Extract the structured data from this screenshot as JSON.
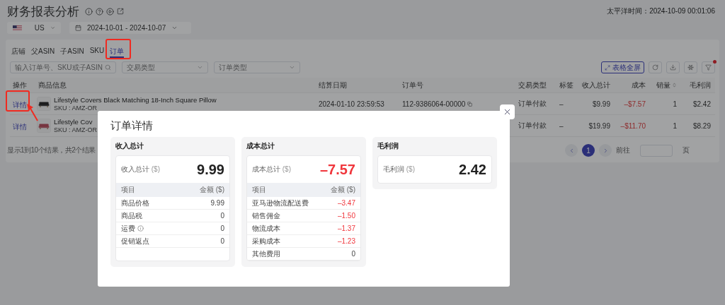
{
  "page": {
    "title": "财务报表分析",
    "timezone": "太平洋时间：2024-10-09 00:01:06"
  },
  "filters": {
    "country": "US",
    "date_range": "2024-10-01 - 2024-10-07"
  },
  "tabs": [
    {
      "label": "店铺",
      "selected": false
    },
    {
      "label": "父ASIN",
      "selected": false
    },
    {
      "label": "子ASIN",
      "selected": false
    },
    {
      "label": "SKU",
      "selected": false
    },
    {
      "label": "订单",
      "selected": true
    }
  ],
  "search": {
    "placeholder": "输入订单号、SKU或子ASIN"
  },
  "selects": [
    {
      "placeholder": "交易类型"
    },
    {
      "placeholder": "订单类型"
    }
  ],
  "toolbar": {
    "fullscreen": "表格全屏",
    "filter_active": true
  },
  "table": {
    "columns": [
      "操作",
      "商品信息",
      "结算日期",
      "订单号",
      "交易类型",
      "标签",
      "收入总计",
      "成本",
      "销量",
      "毛利润"
    ],
    "rows": [
      {
        "action": "详情",
        "title": "Lifestyle Covers Black Matching 18-Inch Square Pillow",
        "sku": "SKU : AMZ-OR",
        "date": "2024-01-10 23:59:53",
        "order": "112-9386064-00000",
        "type": "订单付款",
        "tag": "–",
        "income": "$9.99",
        "cost": "–$7.57",
        "qty": "1",
        "profit": "$2.42"
      },
      {
        "action": "详情",
        "title": "Lifestyle Cov",
        "sku": "SKU : AMZ-OR",
        "type": "订单付款",
        "tag": "–",
        "income": "$19.99",
        "cost": "–$11.70",
        "qty": "1",
        "profit": "$8.29"
      }
    ]
  },
  "pagination": {
    "summary": "显示1到10个结果，共2个结果",
    "pages": [
      {
        "label": "1",
        "selected": true
      }
    ],
    "goto": "前往",
    "suffix": "页"
  },
  "modal": {
    "title": "订单详情",
    "sections": [
      {
        "title": "收入总计",
        "total_label": "收入总计",
        "unit": "($)",
        "total": "9.99",
        "negative": false,
        "header": [
          "项目",
          "金额 ($)"
        ],
        "items": [
          {
            "label": "商品价格",
            "value": "9.99",
            "negative": false,
            "info": false
          },
          {
            "label": "商品税",
            "value": "0",
            "negative": false,
            "info": false
          },
          {
            "label": "运费",
            "value": "0",
            "negative": false,
            "info": true
          },
          {
            "label": "促销返点",
            "value": "0",
            "negative": false,
            "info": false
          }
        ]
      },
      {
        "title": "成本总计",
        "total_label": "成本总计",
        "unit": "($)",
        "total": "–7.57",
        "negative": true,
        "header": [
          "项目",
          "金额 ($)"
        ],
        "items": [
          {
            "label": "亚马逊物流配送费",
            "value": "–3.47",
            "negative": true,
            "info": false
          },
          {
            "label": "销售佣金",
            "value": "–1.50",
            "negative": true,
            "info": false
          },
          {
            "label": "物流成本",
            "value": "–1.37",
            "negative": true,
            "info": false
          },
          {
            "label": "采购成本",
            "value": "–1.23",
            "negative": true,
            "info": false
          },
          {
            "label": "其他费用",
            "value": "0",
            "negative": false,
            "info": false
          }
        ]
      },
      {
        "title": "毛利润",
        "total_label": "毛利润",
        "unit": "($)",
        "total": "2.42",
        "negative": false
      }
    ]
  }
}
